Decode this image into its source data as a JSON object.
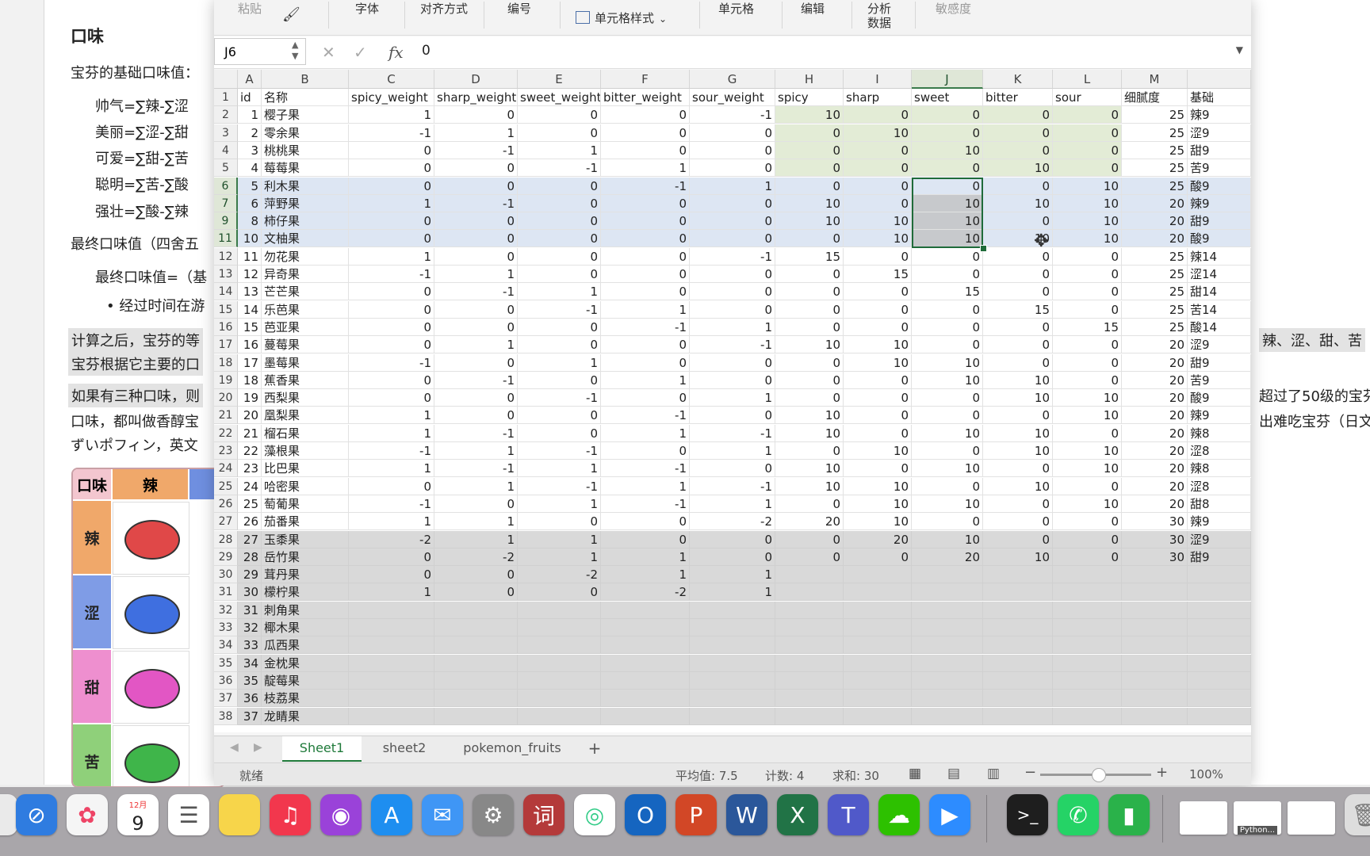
{
  "doc": {
    "heading": "口味",
    "intro": "宝芬的基础口味值：",
    "formulas": [
      "帅气=∑辣-∑涩",
      "美丽=∑涩-∑甜",
      "可爱=∑甜-∑苦",
      "聪明=∑苦-∑酸",
      "强壮=∑酸-∑辣"
    ],
    "final_line": "最终口味值（四舍五",
    "final_formula": "最终口味值=（基",
    "bullet": "经过时间在游",
    "hl1": "计算之后，宝芬的等",
    "hl2": "宝芬根据它主要的口",
    "hl3": "如果有三种口味，则",
    "p1": "口味，都叫做香醇宝",
    "p2": "ずいポフィン，英文",
    "right1": "辣、涩、甜、苦",
    "right2": "超过了50级的宝芬",
    "right3": "出难吃宝芬（日文",
    "table": {
      "header_label": "口味",
      "col1": "辣",
      "rows": [
        "辣",
        "涩",
        "甜",
        "苦"
      ]
    }
  },
  "excel": {
    "ribbon": {
      "paste": "粘贴",
      "font": "字体",
      "align": "对齐方式",
      "number": "编号",
      "cell_style": "单元格样式",
      "cells": "单元格",
      "edit": "编辑",
      "analyze_line1": "分析",
      "analyze_line2": "数据",
      "sensitivity": "敏感度"
    },
    "name_box": "J6",
    "fx_label": "fx",
    "formula_value": "0",
    "columns": [
      "A",
      "B",
      "C",
      "D",
      "E",
      "F",
      "G",
      "H",
      "I",
      "J",
      "K",
      "L",
      "M"
    ],
    "headers": [
      "id",
      "名称",
      "spicy_weight",
      "sharp_weight",
      "sweet_weight",
      "bitter_weight",
      "sour_weight",
      "spicy",
      "sharp",
      "sweet",
      "bitter",
      "sour",
      "细腻度",
      "基础"
    ],
    "row_numbers": [
      "2",
      "3",
      "4",
      "5",
      "6",
      "7",
      "9",
      "11",
      "12",
      "13",
      "14",
      "15",
      "16",
      "17",
      "18",
      "19",
      "20",
      "21",
      "22",
      "23",
      "24",
      "25",
      "26",
      "27",
      "28",
      "29",
      "30",
      "31",
      "32",
      "33",
      "34",
      "35",
      "36",
      "37",
      "38"
    ],
    "rows": [
      [
        "1",
        "樱子果",
        "1",
        "0",
        "0",
        "0",
        "-1",
        "10",
        "0",
        "0",
        "0",
        "0",
        "25",
        "辣9"
      ],
      [
        "2",
        "零余果",
        "-1",
        "1",
        "0",
        "0",
        "0",
        "0",
        "10",
        "0",
        "0",
        "0",
        "25",
        "涩9"
      ],
      [
        "3",
        "桃桃果",
        "0",
        "-1",
        "1",
        "0",
        "0",
        "0",
        "0",
        "10",
        "0",
        "0",
        "25",
        "甜9"
      ],
      [
        "4",
        "莓莓果",
        "0",
        "0",
        "-1",
        "1",
        "0",
        "0",
        "0",
        "0",
        "10",
        "0",
        "25",
        "苦9"
      ],
      [
        "5",
        "利木果",
        "0",
        "0",
        "0",
        "-1",
        "1",
        "0",
        "0",
        "0",
        "0",
        "10",
        "25",
        "酸9"
      ],
      [
        "6",
        "萍野果",
        "1",
        "-1",
        "0",
        "0",
        "0",
        "10",
        "0",
        "10",
        "10",
        "10",
        "20",
        "辣9"
      ],
      [
        "8",
        "柿仔果",
        "0",
        "0",
        "0",
        "0",
        "0",
        "10",
        "10",
        "10",
        "0",
        "10",
        "20",
        "甜9"
      ],
      [
        "10",
        "文柚果",
        "0",
        "0",
        "0",
        "0",
        "0",
        "0",
        "10",
        "10",
        "10",
        "10",
        "20",
        "酸9"
      ],
      [
        "11",
        "勿花果",
        "1",
        "0",
        "0",
        "0",
        "-1",
        "15",
        "0",
        "0",
        "0",
        "0",
        "25",
        "辣14"
      ],
      [
        "12",
        "异奇果",
        "-1",
        "1",
        "0",
        "0",
        "0",
        "0",
        "15",
        "0",
        "0",
        "0",
        "25",
        "涩14"
      ],
      [
        "13",
        "芒芒果",
        "0",
        "-1",
        "1",
        "0",
        "0",
        "0",
        "0",
        "15",
        "0",
        "0",
        "25",
        "甜14"
      ],
      [
        "14",
        "乐芭果",
        "0",
        "0",
        "-1",
        "1",
        "0",
        "0",
        "0",
        "0",
        "15",
        "0",
        "25",
        "苦14"
      ],
      [
        "15",
        "芭亚果",
        "0",
        "0",
        "0",
        "-1",
        "1",
        "0",
        "0",
        "0",
        "0",
        "15",
        "25",
        "酸14"
      ],
      [
        "16",
        "蔓莓果",
        "0",
        "1",
        "0",
        "0",
        "-1",
        "10",
        "10",
        "0",
        "0",
        "0",
        "20",
        "涩9"
      ],
      [
        "17",
        "墨莓果",
        "-1",
        "0",
        "1",
        "0",
        "0",
        "0",
        "10",
        "10",
        "0",
        "0",
        "20",
        "甜9"
      ],
      [
        "18",
        "蕉香果",
        "0",
        "-1",
        "0",
        "1",
        "0",
        "0",
        "0",
        "10",
        "10",
        "0",
        "20",
        "苦9"
      ],
      [
        "19",
        "西梨果",
        "0",
        "0",
        "-1",
        "0",
        "1",
        "0",
        "0",
        "0",
        "10",
        "10",
        "20",
        "酸9"
      ],
      [
        "20",
        "凰梨果",
        "1",
        "0",
        "0",
        "-1",
        "0",
        "10",
        "0",
        "0",
        "0",
        "10",
        "20",
        "辣9"
      ],
      [
        "21",
        "榴石果",
        "1",
        "-1",
        "0",
        "1",
        "-1",
        "10",
        "0",
        "10",
        "10",
        "0",
        "20",
        "辣8"
      ],
      [
        "22",
        "藻根果",
        "-1",
        "1",
        "-1",
        "0",
        "1",
        "0",
        "10",
        "0",
        "10",
        "10",
        "20",
        "涩8"
      ],
      [
        "23",
        "比巴果",
        "1",
        "-1",
        "1",
        "-1",
        "0",
        "10",
        "0",
        "10",
        "0",
        "10",
        "20",
        "辣8"
      ],
      [
        "24",
        "哈密果",
        "0",
        "1",
        "-1",
        "1",
        "-1",
        "10",
        "10",
        "0",
        "10",
        "0",
        "20",
        "涩8"
      ],
      [
        "25",
        "萄葡果",
        "-1",
        "0",
        "1",
        "-1",
        "1",
        "0",
        "10",
        "10",
        "0",
        "10",
        "20",
        "甜8"
      ],
      [
        "26",
        "茄番果",
        "1",
        "1",
        "0",
        "0",
        "-2",
        "20",
        "10",
        "0",
        "0",
        "0",
        "30",
        "辣9"
      ],
      [
        "27",
        "玉黍果",
        "-2",
        "1",
        "1",
        "0",
        "0",
        "0",
        "20",
        "10",
        "0",
        "0",
        "30",
        "涩9"
      ],
      [
        "28",
        "岳竹果",
        "0",
        "-2",
        "1",
        "1",
        "0",
        "0",
        "0",
        "20",
        "10",
        "0",
        "30",
        "甜9"
      ],
      [
        "29",
        "茸丹果",
        "0",
        "0",
        "-2",
        "1",
        "1",
        "",
        "",
        "",
        "",
        "",
        "",
        ""
      ],
      [
        "30",
        "檬柠果",
        "1",
        "0",
        "0",
        "-2",
        "1",
        "",
        "",
        "",
        "",
        "",
        "",
        ""
      ],
      [
        "31",
        "刺角果",
        "",
        "",
        "",
        "",
        "",
        "",
        "",
        "",
        "",
        "",
        "",
        ""
      ],
      [
        "32",
        "椰木果",
        "",
        "",
        "",
        "",
        "",
        "",
        "",
        "",
        "",
        "",
        "",
        ""
      ],
      [
        "33",
        "瓜西果",
        "",
        "",
        "",
        "",
        "",
        "",
        "",
        "",
        "",
        "",
        "",
        ""
      ],
      [
        "34",
        "金枕果",
        "",
        "",
        "",
        "",
        "",
        "",
        "",
        "",
        "",
        "",
        "",
        ""
      ],
      [
        "35",
        "靛莓果",
        "",
        "",
        "",
        "",
        "",
        "",
        "",
        "",
        "",
        "",
        "",
        ""
      ],
      [
        "36",
        "枝荔果",
        "",
        "",
        "",
        "",
        "",
        "",
        "",
        "",
        "",
        "",
        "",
        ""
      ],
      [
        "37",
        "龙睛果",
        "",
        "",
        "",
        "",
        "",
        "",
        "",
        "",
        "",
        "",
        "",
        ""
      ]
    ],
    "tabs": [
      "Sheet1",
      "sheet2",
      "pokemon_fruits"
    ],
    "add_tab": "+",
    "status": {
      "ready": "就绪",
      "average": "平均值: 7.5",
      "count": "计数: 4",
      "sum": "求和: 30",
      "zoom": "100%"
    }
  },
  "dock": {
    "calendar_month": "12月",
    "calendar_day": "9",
    "dict_glyph": "词",
    "thumb_label": "Python..."
  }
}
